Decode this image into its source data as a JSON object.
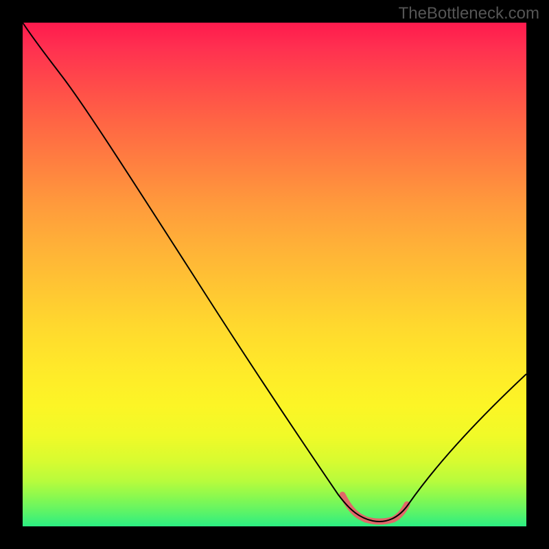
{
  "watermark": "TheBottleneck.com",
  "chart_data": {
    "type": "line",
    "title": "",
    "xlabel": "",
    "ylabel": "",
    "xlim": [
      0,
      100
    ],
    "ylim": [
      0,
      100
    ],
    "grid": false,
    "legend": false,
    "description": "Red-yellow-green vertical gradient (red top to green bottom) with a black curve dipping to a minimum near x≈70 and a pink highlight segment near the minimum.",
    "series": [
      {
        "name": "curve",
        "x": [
          0,
          6,
          12,
          20,
          30,
          40,
          50,
          58,
          64,
          67,
          70,
          73,
          76,
          80,
          86,
          93,
          100
        ],
        "y": [
          100,
          94,
          90,
          80,
          66,
          52,
          37,
          24,
          12,
          5,
          1,
          1,
          2,
          5,
          11,
          20,
          30
        ]
      }
    ],
    "highlight_segment": {
      "x_start": 64,
      "x_end": 76,
      "note": "pink bold segment at curve minimum"
    },
    "gradient_stops": [
      {
        "pos": 0,
        "color": "#ff1a4d"
      },
      {
        "pos": 50,
        "color": "#ffc030"
      },
      {
        "pos": 100,
        "color": "#2cee82"
      }
    ]
  }
}
